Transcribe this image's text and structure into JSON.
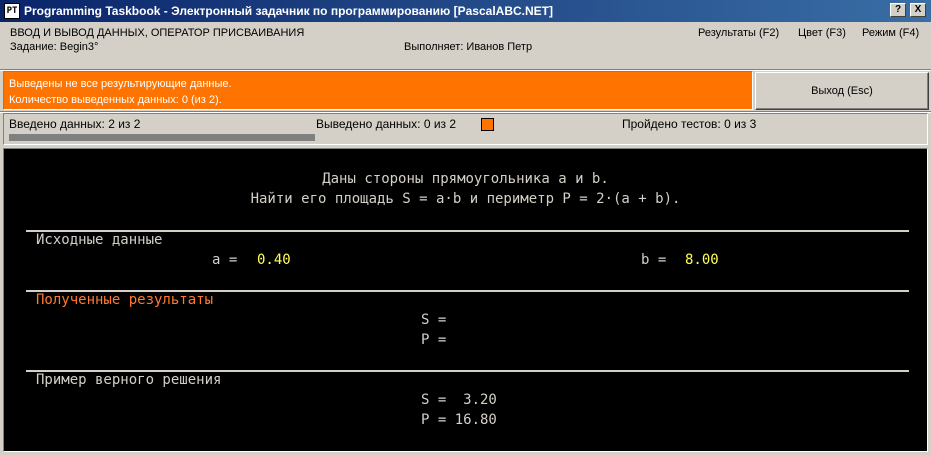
{
  "window": {
    "title": "Programming Taskbook - Электронный задачник по программированию [PascalABC.NET]",
    "icon_text": "PT",
    "help_button": "?",
    "close_button": "X"
  },
  "info": {
    "section_title": "ВВОД И ВЫВОД ДАННЫХ, ОПЕРАТОР ПРИСВАИВАНИЯ",
    "task_label": "Задание: Begin3°",
    "performer": "Выполняет: Иванов Петр",
    "menu": {
      "results": "Результаты (F2)",
      "color": "Цвет (F3)",
      "mode": "Режим (F4)"
    }
  },
  "error": {
    "line1": "Выведены не все результирующие данные.",
    "line2": "Количество выведенных данных: 0 (из 2)."
  },
  "exit_label": "Выход (Esc)",
  "status": {
    "entered": "Введено данных:  2 из 2",
    "output": "Выведено данных:  0 из 2",
    "tests": "Пройдено тестов:  0 из 3",
    "entered_progress": 1.0
  },
  "console": {
    "desc1": "Даны стороны прямоугольника a и b.",
    "desc2": "Найти его площадь S = a·b и периметр P = 2·(a + b).",
    "input_header": "Исходные данные",
    "a_label": "a = ",
    "a_value": "0.40",
    "b_label": "b = ",
    "b_value": "8.00",
    "results_header": "Полученные результаты",
    "res_s": "S =",
    "res_p": "P =",
    "example_header": "Пример верного решения",
    "ex_s": "S =  3.20",
    "ex_p": "P = 16.80"
  },
  "colors": {
    "error_bg": "#ff7400",
    "title_bar": "#0a246a",
    "console_bg": "#000000",
    "highlight_yellow": "#ffff55"
  }
}
